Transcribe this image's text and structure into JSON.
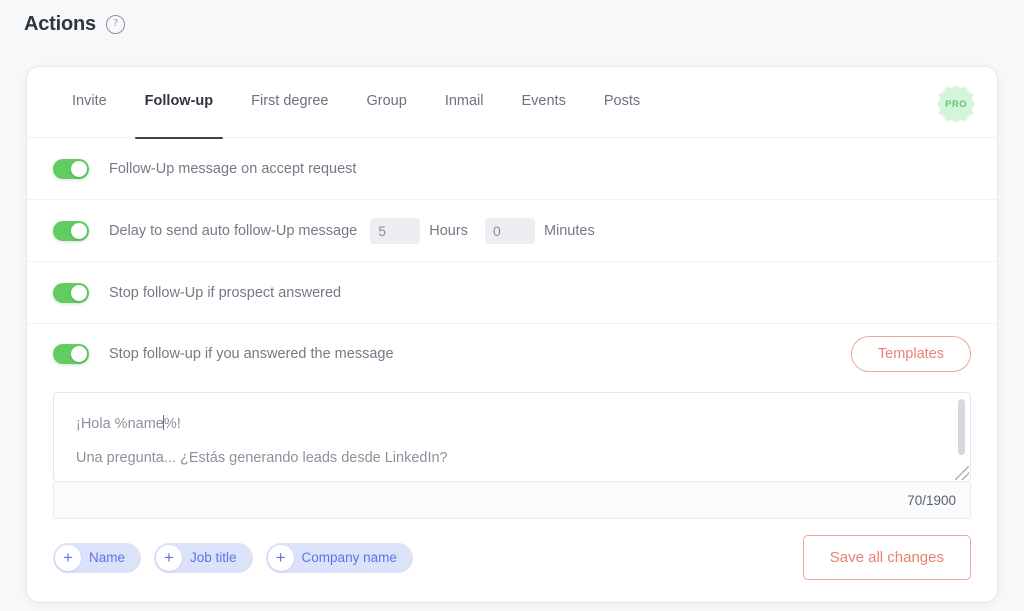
{
  "header": {
    "title": "Actions",
    "help_icon": "question-mark-circle-icon"
  },
  "tabs": [
    {
      "label": "Invite",
      "active": false
    },
    {
      "label": "Follow-up",
      "active": true
    },
    {
      "label": "First degree",
      "active": false
    },
    {
      "label": "Group",
      "active": false
    },
    {
      "label": "Inmail",
      "active": false
    },
    {
      "label": "Events",
      "active": false
    },
    {
      "label": "Posts",
      "active": false
    }
  ],
  "badge": {
    "label": "PRO",
    "bg_color": "#d4f5dc",
    "text_color": "#63c37f"
  },
  "options": [
    {
      "label": "Follow-Up message on accept request",
      "toggle_on": true
    },
    {
      "label": "Delay to send auto follow-Up message",
      "toggle_on": true,
      "hours_value": "5",
      "hours_unit": "Hours",
      "minutes_value": "0",
      "minutes_unit": "Minutes"
    },
    {
      "label": "Stop follow-Up if prospect answered",
      "toggle_on": true
    },
    {
      "label": "Stop follow-up if you answered the message",
      "toggle_on": true,
      "templates_label": "Templates"
    }
  ],
  "editor": {
    "line1_before_caret": "¡Hola %name",
    "line1_after_caret": "%!",
    "line2": "Una pregunta... ¿Estás generando leads desde LinkedIn?",
    "counter": "70/1900"
  },
  "variables": [
    {
      "plus": "+",
      "label": "Name"
    },
    {
      "plus": "+",
      "label": "Job title"
    },
    {
      "plus": "+",
      "label": "Company name"
    }
  ],
  "footer": {
    "save_label": "Save all changes"
  },
  "colors": {
    "toggle_on": "#62cc62",
    "accent_coral": "#ef8274",
    "chip_bg": "#dde2fb",
    "chip_text": "#5b73e8",
    "page_bg": "#f7f8fa"
  }
}
